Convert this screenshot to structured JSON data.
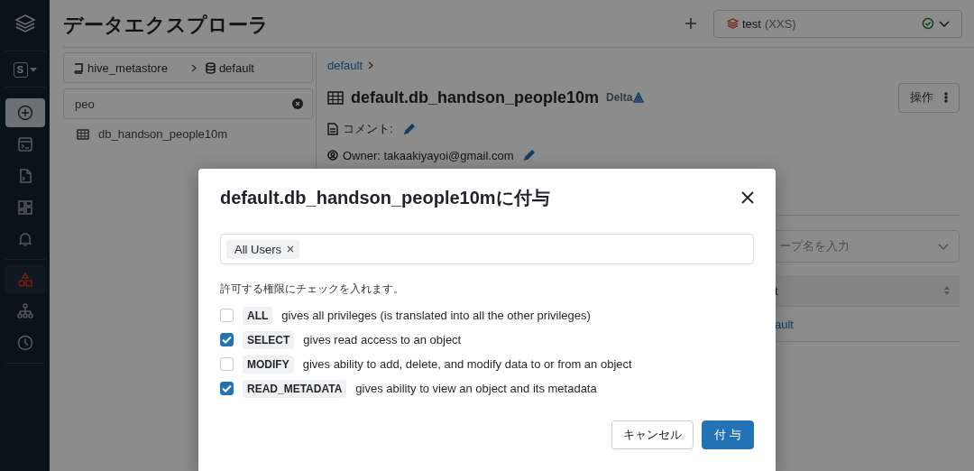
{
  "sidebar": {
    "workspace": {
      "letter": "S"
    },
    "items": [
      {
        "kind": "create",
        "selected": false
      },
      {
        "kind": "sql-editor",
        "selected": false
      },
      {
        "kind": "queries",
        "selected": false
      },
      {
        "kind": "dashboards",
        "selected": false
      },
      {
        "kind": "alerts",
        "selected": false
      },
      {
        "kind": "data",
        "selected": true
      },
      {
        "kind": "compute",
        "selected": false
      },
      {
        "kind": "history",
        "selected": false
      }
    ]
  },
  "header": {
    "title": "データエクスプローラ",
    "warehouse": {
      "name": "test",
      "size": "(XXS)",
      "running": true
    }
  },
  "catalog_panel": {
    "breadcrumb": [
      "hive_metastore",
      "default"
    ],
    "search": {
      "value": "peo"
    },
    "results": [
      {
        "name": "db_handson_people10m"
      }
    ]
  },
  "table_detail": {
    "breadcrumb": "default",
    "title": "default.db_handson_people10m",
    "format": "Delta",
    "actions_label": "操作",
    "comment_label": "コメント:",
    "owner": "Owner: takaakiyayoi@gmail.com",
    "principal_field": {
      "placeholder": "ープ名を入力"
    },
    "grants_table": {
      "column_1": "t",
      "rows": [
        {
          "column_1": "ault"
        }
      ]
    }
  },
  "dialog": {
    "title": "default.db_handson_people10mに付与",
    "principals": [
      {
        "label": "All Users"
      }
    ],
    "instruction": "許可する権限にチェックを入れます。",
    "privileges": [
      {
        "name": "ALL",
        "description": "gives all privileges (is translated into all the other privileges)",
        "checked": false
      },
      {
        "name": "SELECT",
        "description": "gives read access to an object",
        "checked": true
      },
      {
        "name": "MODIFY",
        "description": "gives ability to add, delete, and modify data to or from an object",
        "checked": false
      },
      {
        "name": "READ_METADATA",
        "description": "gives ability to view an object and its metadata",
        "checked": true
      }
    ],
    "buttons": [
      {
        "label": "キャンセル",
        "kind": "secondary"
      },
      {
        "label": "付 与",
        "kind": "primary"
      }
    ]
  }
}
